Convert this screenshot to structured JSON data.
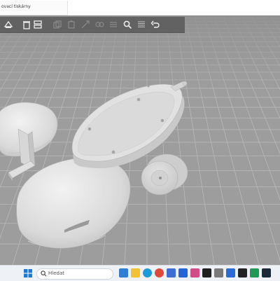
{
  "window": {
    "tab_title": "ovací tiskárny"
  },
  "toolbar": {
    "tools": [
      {
        "name": "add-object-icon",
        "color": "#f0f0f0"
      },
      {
        "name": "delete-icon",
        "color": "#f0f0f0"
      },
      {
        "name": "arrange-icon",
        "color": "#f0f0f0"
      },
      {
        "name": "copy-icon",
        "color": "#8a8a8a"
      },
      {
        "name": "paste-icon",
        "color": "#8a8a8a"
      },
      {
        "name": "scale-icon",
        "color": "#8a8a8a"
      },
      {
        "name": "split-icon",
        "color": "#8a8a8a"
      },
      {
        "name": "variable-layer-icon",
        "color": "#8a8a8a"
      },
      {
        "name": "search-icon",
        "color": "#f0f0f0"
      },
      {
        "name": "layers-icon",
        "color": "#bdbdbd"
      },
      {
        "name": "undo-icon",
        "color": "#f0f0f0"
      }
    ]
  },
  "taskbar": {
    "search_placeholder": "Hledat",
    "apps": [
      {
        "name": "widgets-app-icon",
        "color": "#2f7fd6"
      },
      {
        "name": "file-explorer-app-icon",
        "color": "#f1c232"
      },
      {
        "name": "edge-app-icon",
        "color": "#1d9bd8"
      },
      {
        "name": "chrome-app-icon",
        "color": "#de4a3a"
      },
      {
        "name": "store-app-icon",
        "color": "#3c6fd1"
      },
      {
        "name": "dropbox-app-icon",
        "color": "#2563d9"
      },
      {
        "name": "photos-app-icon",
        "color": "#d14d8a"
      },
      {
        "name": "slicer-app-icon",
        "color": "#1f1f1f"
      },
      {
        "name": "settings-app-icon",
        "color": "#7a7a7a"
      },
      {
        "name": "mail-app-icon",
        "color": "#2b6bd6"
      },
      {
        "name": "terminal-app-icon",
        "color": "#222222"
      },
      {
        "name": "bambu-app-icon",
        "color": "#1e9a55"
      },
      {
        "name": "steam-app-icon",
        "color": "#1b2838"
      }
    ]
  },
  "colors": {
    "viewport_bg": "#9d9d9d",
    "grid_line": "#b9b9b9",
    "model": "#e7e7e7",
    "toolbar_bg": "#626262"
  }
}
